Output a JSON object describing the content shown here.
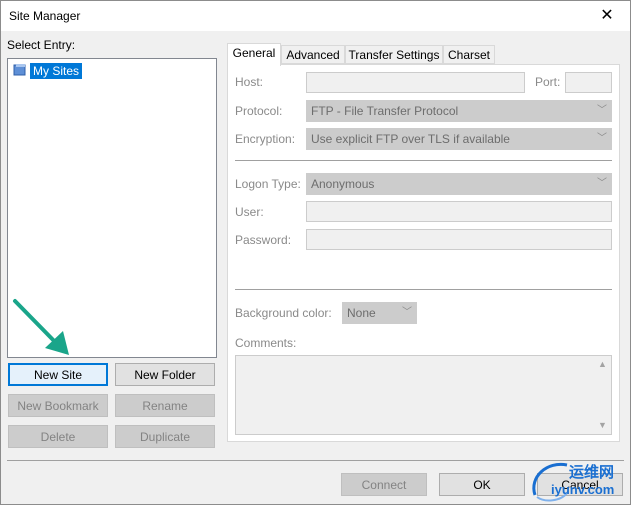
{
  "window": {
    "title": "Site Manager"
  },
  "left": {
    "select_entry_label": "Select Entry:",
    "tree": [
      {
        "label": "My Sites",
        "icon": "folder-icon",
        "selected": true
      }
    ],
    "buttons": {
      "new_site": "New Site",
      "new_folder": "New Folder",
      "new_bookmark": "New Bookmark",
      "rename": "Rename",
      "delete": "Delete",
      "duplicate": "Duplicate"
    }
  },
  "tabs": [
    "General",
    "Advanced",
    "Transfer Settings",
    "Charset"
  ],
  "general": {
    "host_label": "Host:",
    "host_value": "",
    "port_label": "Port:",
    "port_value": "",
    "protocol_label": "Protocol:",
    "protocol_value": "FTP - File Transfer Protocol",
    "encryption_label": "Encryption:",
    "encryption_value": "Use explicit FTP over TLS if available",
    "logon_type_label": "Logon Type:",
    "logon_type_value": "Anonymous",
    "user_label": "User:",
    "user_value": "",
    "password_label": "Password:",
    "password_value": "",
    "background_color_label": "Background color:",
    "background_color_value": "None",
    "comments_label": "Comments:",
    "comments_value": ""
  },
  "footer": {
    "connect": "Connect",
    "ok": "OK",
    "cancel": "Cancel"
  },
  "watermark": {
    "cn": "运维网",
    "url": "iyunv.com"
  },
  "colors": {
    "accent": "#0078d7",
    "arrow": "#1aa58a",
    "watermark_blue": "#1a6fd1"
  }
}
